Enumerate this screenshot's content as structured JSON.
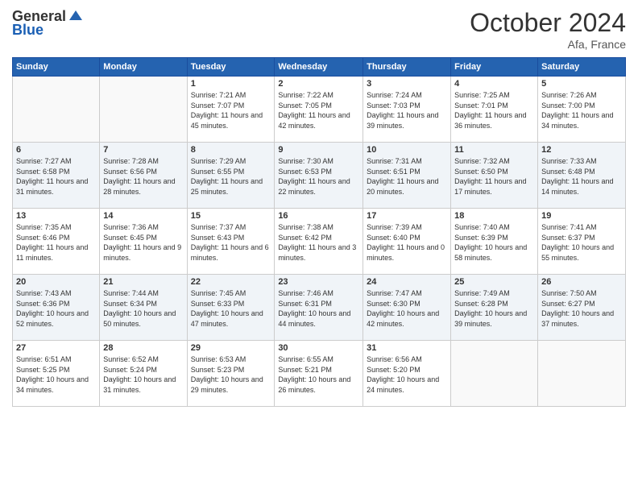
{
  "header": {
    "logo_general": "General",
    "logo_blue": "Blue",
    "month_title": "October 2024",
    "location": "Afa, France"
  },
  "weekdays": [
    "Sunday",
    "Monday",
    "Tuesday",
    "Wednesday",
    "Thursday",
    "Friday",
    "Saturday"
  ],
  "weeks": [
    [
      {
        "day": "",
        "info": ""
      },
      {
        "day": "",
        "info": ""
      },
      {
        "day": "1",
        "info": "Sunrise: 7:21 AM\nSunset: 7:07 PM\nDaylight: 11 hours and 45 minutes."
      },
      {
        "day": "2",
        "info": "Sunrise: 7:22 AM\nSunset: 7:05 PM\nDaylight: 11 hours and 42 minutes."
      },
      {
        "day": "3",
        "info": "Sunrise: 7:24 AM\nSunset: 7:03 PM\nDaylight: 11 hours and 39 minutes."
      },
      {
        "day": "4",
        "info": "Sunrise: 7:25 AM\nSunset: 7:01 PM\nDaylight: 11 hours and 36 minutes."
      },
      {
        "day": "5",
        "info": "Sunrise: 7:26 AM\nSunset: 7:00 PM\nDaylight: 11 hours and 34 minutes."
      }
    ],
    [
      {
        "day": "6",
        "info": "Sunrise: 7:27 AM\nSunset: 6:58 PM\nDaylight: 11 hours and 31 minutes."
      },
      {
        "day": "7",
        "info": "Sunrise: 7:28 AM\nSunset: 6:56 PM\nDaylight: 11 hours and 28 minutes."
      },
      {
        "day": "8",
        "info": "Sunrise: 7:29 AM\nSunset: 6:55 PM\nDaylight: 11 hours and 25 minutes."
      },
      {
        "day": "9",
        "info": "Sunrise: 7:30 AM\nSunset: 6:53 PM\nDaylight: 11 hours and 22 minutes."
      },
      {
        "day": "10",
        "info": "Sunrise: 7:31 AM\nSunset: 6:51 PM\nDaylight: 11 hours and 20 minutes."
      },
      {
        "day": "11",
        "info": "Sunrise: 7:32 AM\nSunset: 6:50 PM\nDaylight: 11 hours and 17 minutes."
      },
      {
        "day": "12",
        "info": "Sunrise: 7:33 AM\nSunset: 6:48 PM\nDaylight: 11 hours and 14 minutes."
      }
    ],
    [
      {
        "day": "13",
        "info": "Sunrise: 7:35 AM\nSunset: 6:46 PM\nDaylight: 11 hours and 11 minutes."
      },
      {
        "day": "14",
        "info": "Sunrise: 7:36 AM\nSunset: 6:45 PM\nDaylight: 11 hours and 9 minutes."
      },
      {
        "day": "15",
        "info": "Sunrise: 7:37 AM\nSunset: 6:43 PM\nDaylight: 11 hours and 6 minutes."
      },
      {
        "day": "16",
        "info": "Sunrise: 7:38 AM\nSunset: 6:42 PM\nDaylight: 11 hours and 3 minutes."
      },
      {
        "day": "17",
        "info": "Sunrise: 7:39 AM\nSunset: 6:40 PM\nDaylight: 11 hours and 0 minutes."
      },
      {
        "day": "18",
        "info": "Sunrise: 7:40 AM\nSunset: 6:39 PM\nDaylight: 10 hours and 58 minutes."
      },
      {
        "day": "19",
        "info": "Sunrise: 7:41 AM\nSunset: 6:37 PM\nDaylight: 10 hours and 55 minutes."
      }
    ],
    [
      {
        "day": "20",
        "info": "Sunrise: 7:43 AM\nSunset: 6:36 PM\nDaylight: 10 hours and 52 minutes."
      },
      {
        "day": "21",
        "info": "Sunrise: 7:44 AM\nSunset: 6:34 PM\nDaylight: 10 hours and 50 minutes."
      },
      {
        "day": "22",
        "info": "Sunrise: 7:45 AM\nSunset: 6:33 PM\nDaylight: 10 hours and 47 minutes."
      },
      {
        "day": "23",
        "info": "Sunrise: 7:46 AM\nSunset: 6:31 PM\nDaylight: 10 hours and 44 minutes."
      },
      {
        "day": "24",
        "info": "Sunrise: 7:47 AM\nSunset: 6:30 PM\nDaylight: 10 hours and 42 minutes."
      },
      {
        "day": "25",
        "info": "Sunrise: 7:49 AM\nSunset: 6:28 PM\nDaylight: 10 hours and 39 minutes."
      },
      {
        "day": "26",
        "info": "Sunrise: 7:50 AM\nSunset: 6:27 PM\nDaylight: 10 hours and 37 minutes."
      }
    ],
    [
      {
        "day": "27",
        "info": "Sunrise: 6:51 AM\nSunset: 5:25 PM\nDaylight: 10 hours and 34 minutes."
      },
      {
        "day": "28",
        "info": "Sunrise: 6:52 AM\nSunset: 5:24 PM\nDaylight: 10 hours and 31 minutes."
      },
      {
        "day": "29",
        "info": "Sunrise: 6:53 AM\nSunset: 5:23 PM\nDaylight: 10 hours and 29 minutes."
      },
      {
        "day": "30",
        "info": "Sunrise: 6:55 AM\nSunset: 5:21 PM\nDaylight: 10 hours and 26 minutes."
      },
      {
        "day": "31",
        "info": "Sunrise: 6:56 AM\nSunset: 5:20 PM\nDaylight: 10 hours and 24 minutes."
      },
      {
        "day": "",
        "info": ""
      },
      {
        "day": "",
        "info": ""
      }
    ]
  ]
}
